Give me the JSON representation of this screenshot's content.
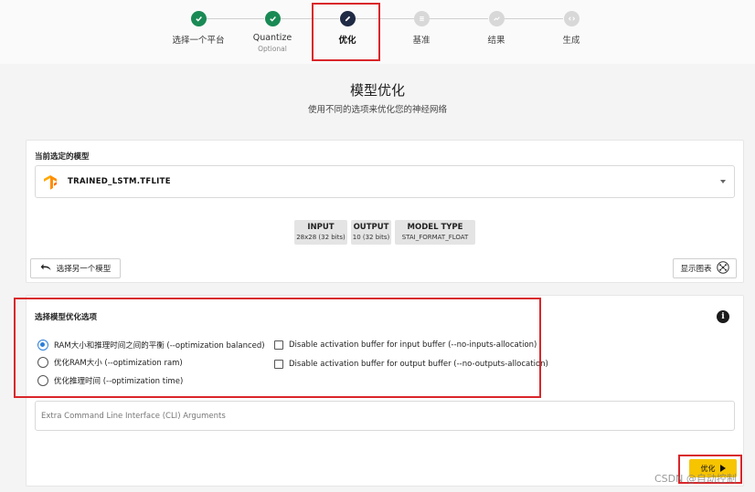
{
  "stepper": {
    "steps": [
      {
        "label": "选择一个平台",
        "sublabel": "",
        "state": "done"
      },
      {
        "label": "Quantize",
        "sublabel": "Optional",
        "state": "done"
      },
      {
        "label": "优化",
        "sublabel": "",
        "state": "active"
      },
      {
        "label": "基准",
        "sublabel": "",
        "state": "todo"
      },
      {
        "label": "结果",
        "sublabel": "",
        "state": "todo"
      },
      {
        "label": "生成",
        "sublabel": "",
        "state": "todo"
      }
    ]
  },
  "header": {
    "title": "模型优化",
    "subtitle": "使用不同的选项来优化您的神经网络"
  },
  "model_card": {
    "heading": "当前选定的模型",
    "model_name": "TRAINED_LSTM.TFLITE",
    "io": [
      {
        "key": "INPUT",
        "value": "28x28 (32 bits)"
      },
      {
        "key": "OUTPUT",
        "value": "10 (32 bits)"
      },
      {
        "key": "MODEL TYPE",
        "value": "STAI_FORMAT_FLOAT"
      }
    ],
    "select_other_label": "选择另一个模型",
    "show_graph_label": "显示图表"
  },
  "options_card": {
    "heading": "选择模型优化选项",
    "radios": [
      {
        "label": "RAM大小和推理时间之间的平衡 (--optimization balanced)",
        "selected": true
      },
      {
        "label": "优化RAM大小 (--optimization ram)",
        "selected": false
      },
      {
        "label": "优化推理时间 (--optimization time)",
        "selected": false
      }
    ],
    "checkboxes": [
      {
        "label": "Disable activation buffer for input buffer (--no-inputs-allocation)",
        "checked": false
      },
      {
        "label": "Disable activation buffer for output buffer (--no-outputs-allocation)",
        "checked": false
      }
    ],
    "cli_value": "",
    "cli_placeholder": "Extra Command Line Interface (CLI) Arguments",
    "run_label": "优化"
  },
  "watermark": "CSDN @自动控制",
  "colors": {
    "done": "#1a8a55",
    "active": "#1f2a44",
    "todo": "#d8d8d8",
    "accent_blue": "#2b7fd8",
    "run_button": "#f7c400",
    "highlight_red": "#d9262a"
  }
}
